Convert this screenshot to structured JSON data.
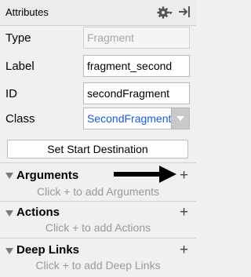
{
  "header": {
    "title": "Attributes",
    "gear_icon": "gear-icon",
    "pin_icon": "pin-panel-icon"
  },
  "fields": {
    "type": {
      "label": "Type",
      "value": "Fragment"
    },
    "label": {
      "label": "Label",
      "value": "fragment_second"
    },
    "id": {
      "label": "ID",
      "value": "secondFragment"
    },
    "class": {
      "label": "Class",
      "value": "SecondFragment"
    }
  },
  "button": {
    "label": "Set Start Destination"
  },
  "sections": [
    {
      "title": "Arguments",
      "hint": "Click + to add Arguments",
      "add": "+"
    },
    {
      "title": "Actions",
      "hint": "Click + to add Actions",
      "add": "+"
    },
    {
      "title": "Deep Links",
      "hint": "Click + to add Deep Links",
      "add": "+"
    }
  ],
  "colors": {
    "class_value": "#1a57e8",
    "annotation_arrow": "#000000"
  }
}
